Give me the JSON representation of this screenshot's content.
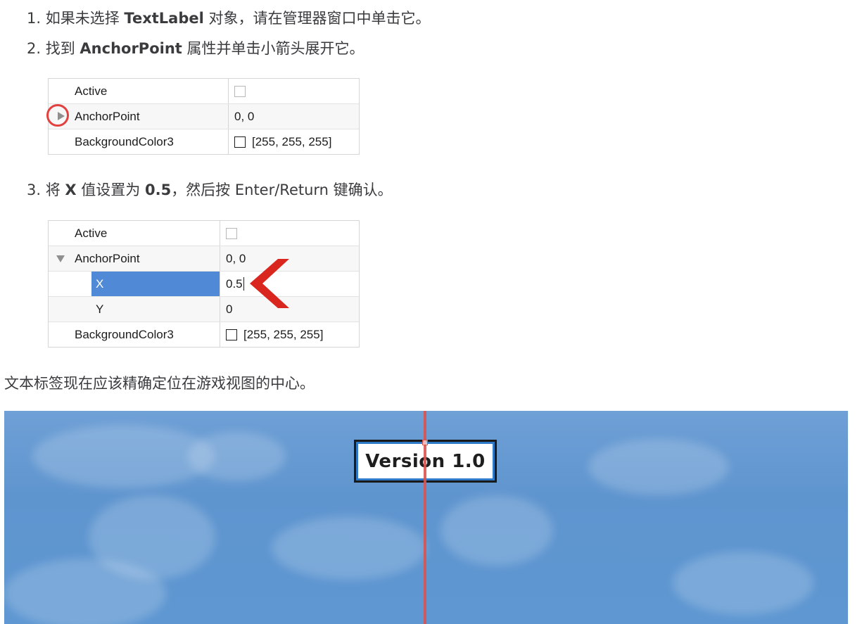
{
  "steps": [
    {
      "number": "1.",
      "text_before": "如果未选择 ",
      "bold": "TextLabel",
      "text_after": " 对象，请在管理器窗口中单击它。"
    },
    {
      "number": "2.",
      "text_before": "找到 ",
      "bold": "AnchorPoint",
      "text_after": " 属性并单击小箭头展开它。"
    },
    {
      "number": "3.",
      "text_before": "将 ",
      "bold": "X",
      "text_middle": " 值设置为 ",
      "bold2": "0.5",
      "text_after": "，然后按 Enter/Return 键确认。"
    }
  ],
  "table_collapsed": {
    "rows": [
      {
        "name": "Active",
        "value": ""
      },
      {
        "name": "AnchorPoint",
        "value": "0, 0"
      },
      {
        "name": "BackgroundColor3",
        "value": "[255, 255, 255]"
      }
    ]
  },
  "table_expanded": {
    "rows": [
      {
        "name": "Active",
        "value": ""
      },
      {
        "name": "AnchorPoint",
        "value": "0, 0"
      },
      {
        "name": "X",
        "value": "0.5"
      },
      {
        "name": "Y",
        "value": "0"
      },
      {
        "name": "BackgroundColor3",
        "value": "[255, 255, 255]"
      }
    ]
  },
  "summary": "文本标签现在应该精确定位在游戏视图的中心。",
  "game_view": {
    "label_text": "Version 1.0"
  },
  "colors": {
    "highlight_circle": "#e3413f",
    "selection": "#5089d6",
    "pointer_chevron": "#d9261f",
    "center_line": "#d9534f",
    "sky": "#5f95cf"
  }
}
